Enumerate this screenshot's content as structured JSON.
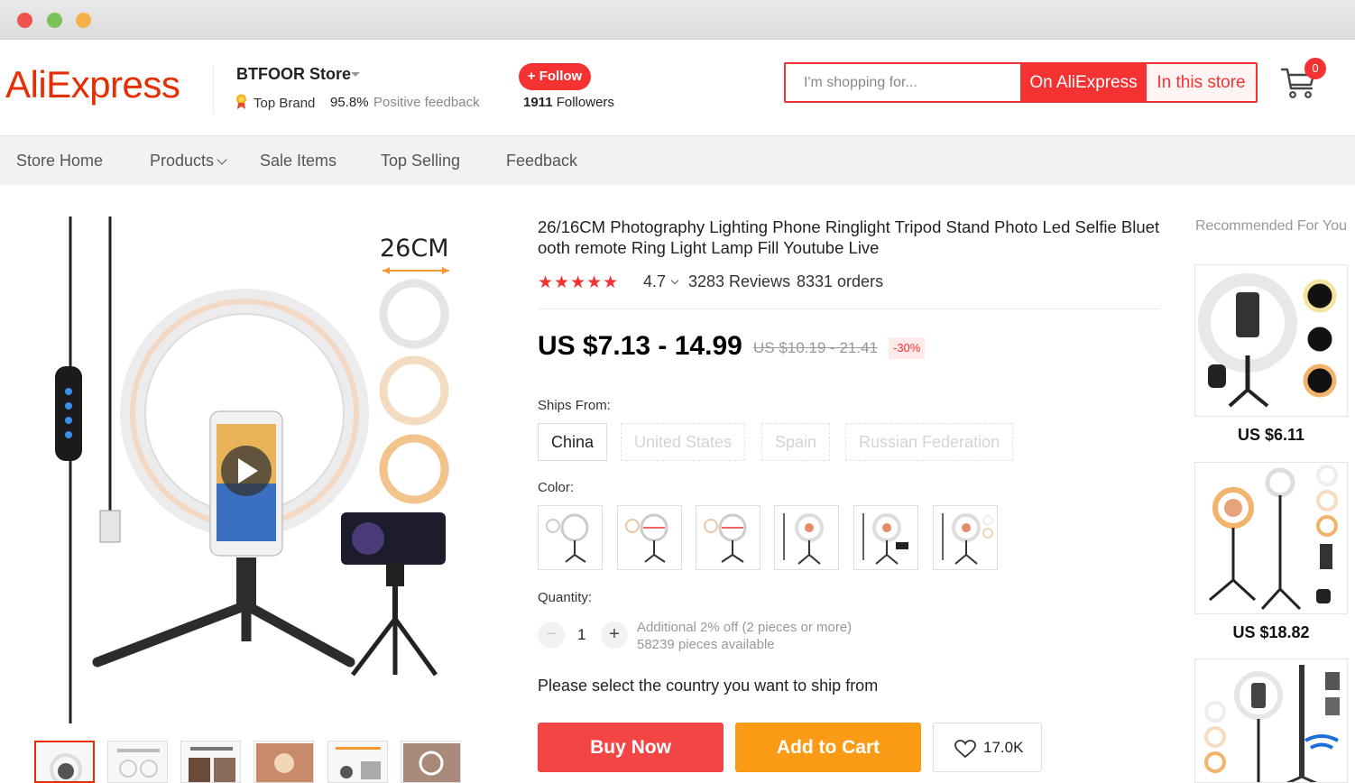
{
  "store": {
    "logo": "AliExpress",
    "name": "BTFOOR Store",
    "top_brand": "Top Brand",
    "positive_pct": "95.8%",
    "positive_label": "Positive feedback",
    "follow_label": "+ Follow",
    "followers_count": "1911",
    "followers_label": "Followers"
  },
  "search": {
    "placeholder": "I'm shopping for...",
    "btn_all": "On AliExpress",
    "btn_store": "In this store"
  },
  "cart": {
    "count": "0"
  },
  "nav": {
    "items": [
      "Store Home",
      "Products",
      "Sale Items",
      "Top Selling",
      "Feedback"
    ]
  },
  "product": {
    "title": "26/16CM Photography Lighting Phone Ringlight Tripod Stand Photo Led Selfie Bluetooth remote Ring Light Lamp Fill Youtube Live",
    "size_label": "26CM",
    "stars": "★★★★★",
    "rating": "4.7",
    "reviews": "3283 Reviews",
    "orders": "8331 orders",
    "price": "US $7.13 - 14.99",
    "old_price": "US $10.19 - 21.41",
    "discount": "-30%",
    "ships_from_label": "Ships From:",
    "ships_from": [
      {
        "label": "China",
        "available": true
      },
      {
        "label": "United States",
        "available": false
      },
      {
        "label": "Spain",
        "available": false
      },
      {
        "label": "Russian Federation",
        "available": false
      }
    ],
    "color_label": "Color:",
    "quantity_label": "Quantity:",
    "quantity": "1",
    "qty_minus": "−",
    "qty_plus": "+",
    "bulk_note": "Additional 2% off (2 pieces or more)",
    "available_note": "58239 pieces available",
    "ship_note": "Please select the country you want to ship from",
    "buy_now": "Buy Now",
    "add_to_cart": "Add to Cart",
    "wishlist_count": "17.0K"
  },
  "recommended": {
    "title": "Recommended For You",
    "items": [
      {
        "price": "US $6.11"
      },
      {
        "price": "US $18.82"
      },
      {
        "price": ""
      }
    ]
  },
  "colors": {
    "accent": "#f43232",
    "logo": "#e62e04",
    "add_to_cart": "#fb9a14"
  }
}
